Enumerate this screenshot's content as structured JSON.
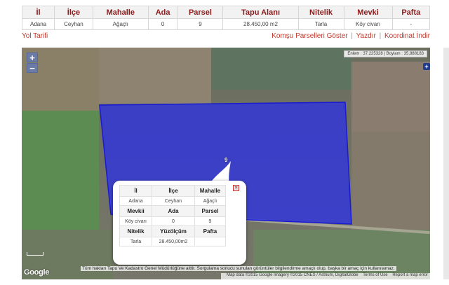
{
  "info_table": {
    "headers": [
      "İl",
      "İlçe",
      "Mahalle",
      "Ada",
      "Parsel",
      "Tapu Alanı",
      "Nitelik",
      "Mevki",
      "Pafta"
    ],
    "row": [
      "Adana",
      "Ceyhan",
      "Ağaçlı",
      "0",
      "9",
      "28.450,00 m2",
      "Tarla",
      "Köy civarı",
      "-"
    ]
  },
  "actions": {
    "directions": "Yol Tarifi",
    "neighbor_parcels": "Komşu Parselleri Göster",
    "print": "Yazdır",
    "download_coords": "Koordinat İndir",
    "separator": "|"
  },
  "map": {
    "coords": "Enlem : 37,225328 | Boylam : 35,888183",
    "zoom_in": "+",
    "zoom_out": "−",
    "expand": "+",
    "parcel_label": "9",
    "google": "Google",
    "notice": "Tüm hakları Tapu Ve Kadastro Genel Müdürlüğüne aittir. Sorgulama sonucu sunulan görüntüler bilgilendirme amaçlı olup, başka bir amaç için kullanılamaz.",
    "map_data": "Map data ©2015 Google Imagery ©2015 CNES / Astrium, DigitalGlobe",
    "terms": "Terms of Use",
    "report": "Report a map error",
    "polygon_color": "#2a2fe8"
  },
  "popup": {
    "close": "×",
    "row1_headers": [
      "İl",
      "İlçe",
      "Mahalle"
    ],
    "row1_values": [
      "Adana",
      "Ceyhan",
      "Ağaçlı"
    ],
    "row2_headers": [
      "Mevkii",
      "Ada",
      "Parsel"
    ],
    "row2_values": [
      "Köy civarı",
      "0",
      "9"
    ],
    "row3_headers": [
      "Nitelik",
      "Yüzölçüm",
      "Pafta"
    ],
    "row3_values": [
      "Tarla",
      "28.450,00m2",
      ""
    ]
  }
}
